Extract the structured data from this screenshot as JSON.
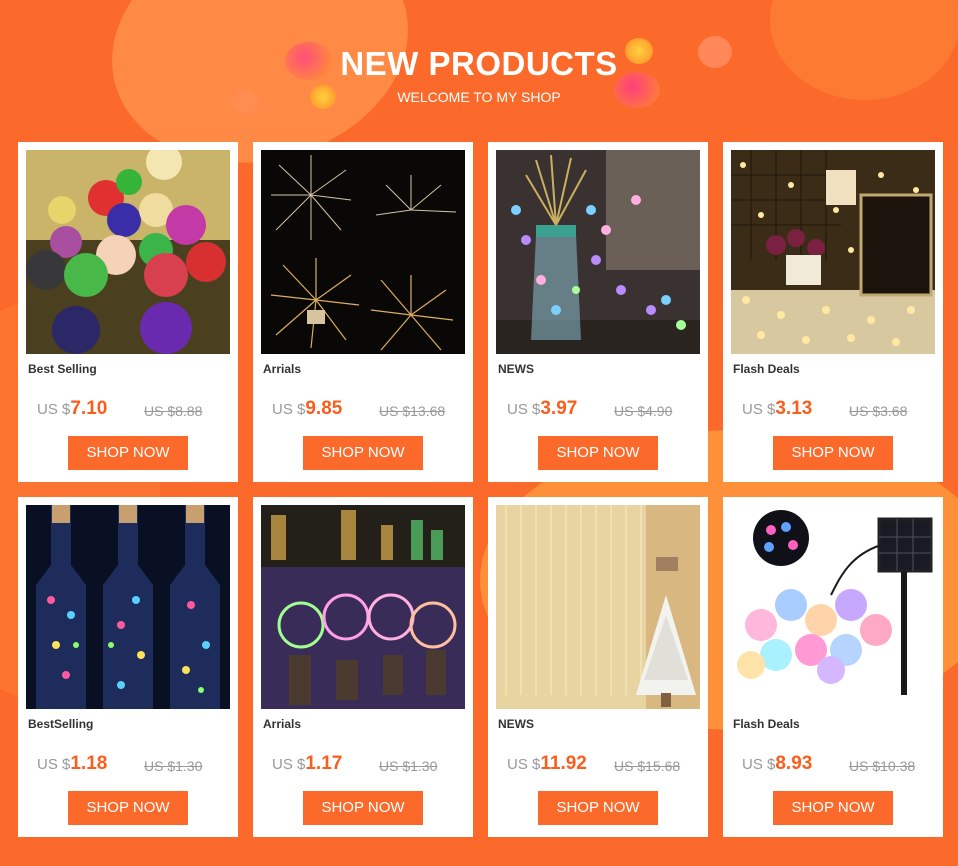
{
  "header": {
    "title": "NEW PRODUCTS",
    "subtitle": "WELCOME TO MY SHOP"
  },
  "products": [
    {
      "category": "Best Selling",
      "currency": "US $",
      "price": "7.10",
      "old_price": "US $8.88",
      "button": "SHOP NOW"
    },
    {
      "category": "Arrials",
      "currency": "US $",
      "price": "9.85",
      "old_price": "US $13.68",
      "button": "SHOP NOW"
    },
    {
      "category": "NEWS",
      "currency": "US $",
      "price": "3.97",
      "old_price": "US $4.90",
      "button": "SHOP NOW"
    },
    {
      "category": "Flash Deals",
      "currency": "US $",
      "price": "3.13",
      "old_price": "US $3.68",
      "button": "SHOP NOW"
    },
    {
      "category": "BestSelling",
      "currency": "US $",
      "price": "1.18",
      "old_price": "US $1.30",
      "button": "SHOP NOW"
    },
    {
      "category": "Arrials",
      "currency": "US $",
      "price": "1.17",
      "old_price": "US $1.30",
      "button": "SHOP NOW"
    },
    {
      "category": "NEWS",
      "currency": "US $",
      "price": "11.92",
      "old_price": "US $15.68",
      "button": "SHOP NOW"
    },
    {
      "category": "Flash Deals",
      "currency": "US $",
      "price": "8.93",
      "old_price": "US $10.38",
      "button": "SHOP NOW"
    }
  ],
  "colors": {
    "background": "#fb6a2a",
    "accent": "#fb5d1d",
    "button": "#fb6a2a"
  }
}
